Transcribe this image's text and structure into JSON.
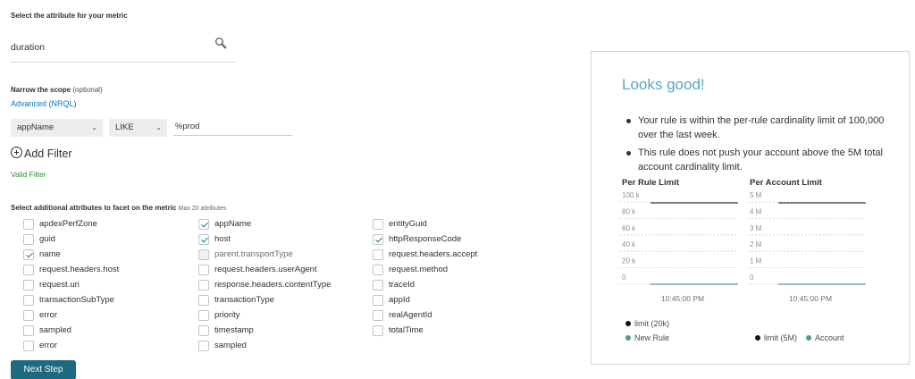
{
  "attribute": {
    "title": "Select the attribute for your metric",
    "value": "duration",
    "icon": "search-icon"
  },
  "scope": {
    "title": "Narrow the scope",
    "optional": "(optional)",
    "advanced_link": "Advanced (NRQL)",
    "filter": {
      "attribute": "appName",
      "operator": "LIKE",
      "value": "%prod"
    },
    "add_filter": "Add Filter",
    "valid_filter": "Valid Filter"
  },
  "facets": {
    "title": "Select additional attributes to facet on the metric",
    "max": "Max 20 attributes",
    "columns": [
      [
        {
          "label": "apdexPerfZone",
          "checked": false
        },
        {
          "label": "guid",
          "checked": false
        },
        {
          "label": "name",
          "checked": true
        },
        {
          "label": "request.headers.host",
          "checked": false
        },
        {
          "label": "request.uri",
          "checked": false
        },
        {
          "label": "transactionSubType",
          "checked": false
        },
        {
          "label": "error",
          "checked": false
        },
        {
          "label": "sampled",
          "checked": false
        },
        {
          "label": "error",
          "checked": false
        }
      ],
      [
        {
          "label": "appName",
          "checked": true
        },
        {
          "label": "host",
          "checked": true
        },
        {
          "label": "parent.transportType",
          "checked": false,
          "disabled": true
        },
        {
          "label": "request.headers.userAgent",
          "checked": false
        },
        {
          "label": "response.headers.contentType",
          "checked": false
        },
        {
          "label": "transactionType",
          "checked": false
        },
        {
          "label": "priority",
          "checked": false
        },
        {
          "label": "timestamp",
          "checked": false
        },
        {
          "label": "sampled",
          "checked": false
        }
      ],
      [
        {
          "label": "entityGuid",
          "checked": false
        },
        {
          "label": "httpResponseCode",
          "checked": true
        },
        {
          "label": "request.headers.accept",
          "checked": false
        },
        {
          "label": "request.method",
          "checked": false
        },
        {
          "label": "traceId",
          "checked": false
        },
        {
          "label": "appId",
          "checked": false
        },
        {
          "label": "realAgentId",
          "checked": false
        },
        {
          "label": "totalTime",
          "checked": false
        }
      ]
    ]
  },
  "next_button": "Next Step",
  "panel": {
    "title": "Looks good!",
    "bullets": [
      "Your rule is within the per-rule cardinality limit of 100,000 over the last week.",
      "This rule does not push your account above the 5M total account cardinality limit."
    ],
    "colors": {
      "limit": "#111111",
      "series": "#4b9c8f",
      "title": "#57a5c6"
    }
  },
  "chart_data": [
    {
      "type": "line",
      "title": "Per Rule Limit",
      "ytick_labels": [
        "100 k",
        "80 k",
        "60 k",
        "40 k",
        "20 k",
        "0"
      ],
      "xtick_labels": [
        "10:45:00 PM"
      ],
      "ylim": [
        0,
        100000
      ],
      "series": [
        {
          "name": "limit (20k)",
          "values": [
            100000,
            100000
          ]
        },
        {
          "name": "New Rule",
          "values": [
            0,
            0
          ]
        }
      ]
    },
    {
      "type": "line",
      "title": "Per Account Limit",
      "ytick_labels": [
        "5 M",
        "4 M",
        "3 M",
        "2 M",
        "1 M",
        "0"
      ],
      "xtick_labels": [
        "10:45:00 PM"
      ],
      "ylim": [
        0,
        5000000
      ],
      "series": [
        {
          "name": "limit (5M)",
          "values": [
            5000000,
            5000000
          ]
        },
        {
          "name": "Account",
          "values": [
            0,
            0
          ]
        }
      ]
    }
  ]
}
